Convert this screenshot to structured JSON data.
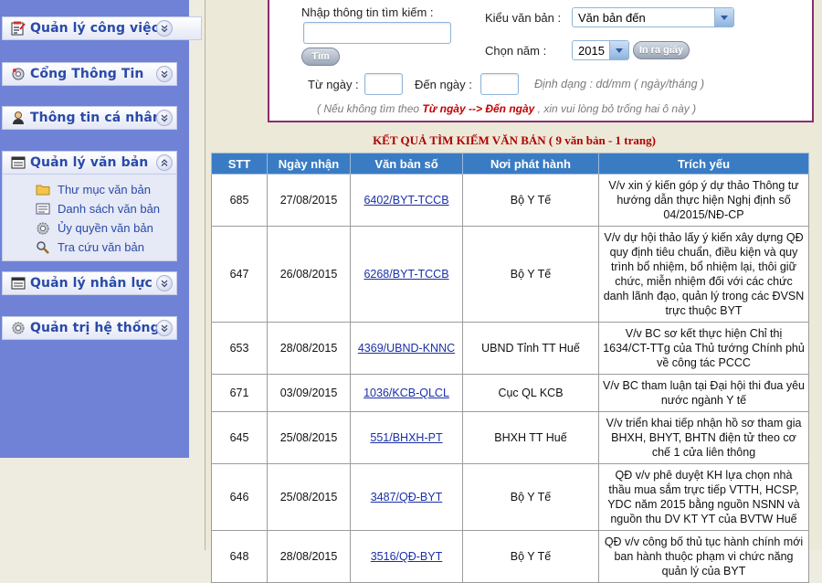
{
  "sidebar": {
    "sections": [
      {
        "title": "Quản lý công việc",
        "icon": "task-board-icon"
      },
      {
        "title": "Cổng Thông Tin",
        "icon": "portal-gear-icon"
      },
      {
        "title": "Thông tin cá nhân",
        "icon": "person-icon"
      },
      {
        "title": "Quản lý văn bản",
        "icon": "document-icon",
        "items": [
          {
            "label": "Thư mục văn bản",
            "icon": "folder-icon"
          },
          {
            "label": "Danh sách văn bản",
            "icon": "list-icon"
          },
          {
            "label": "Ủy quyền văn bản",
            "icon": "gear-icon"
          },
          {
            "label": "Tra cứu văn bản",
            "icon": "magnifier-icon"
          }
        ]
      },
      {
        "title": "Quản lý nhân lực",
        "icon": "document-icon"
      },
      {
        "title": "Quản trị hệ thống",
        "icon": "gear-icon"
      }
    ]
  },
  "search": {
    "keyword_label": "Nhập thông tin tìm kiếm :",
    "keyword_value": "",
    "search_button": "Tìm",
    "doc_type_label": "Kiểu văn bản :",
    "doc_type_value": "Văn bản đến",
    "year_label": "Chọn năm :",
    "year_value": "2015",
    "print_button": "In ra giấy",
    "from_label": "Từ ngày :",
    "to_label": "Đến ngày :",
    "format_hint": "Định dạng : dd/mm ( ngày/tháng )",
    "note_prefix": "( Nếu không tìm theo",
    "note_highlight": "Từ ngày --> Đến ngày",
    "note_suffix": ", xin vui lòng bỏ trống hai ô này )"
  },
  "results": {
    "title": "KẾT QUẢ TÌM KIẾM VĂN BẢN ( 9 văn bản - 1 trang)",
    "columns": [
      "STT",
      "Ngày nhận",
      "Văn bản số",
      "Nơi phát hành",
      "Trích yếu"
    ],
    "rows": [
      [
        "685",
        "27/08/2015",
        "6402/BYT-TCCB",
        "Bộ Y Tế",
        "V/v xin ý kiến góp ý dự thảo Thông tư hướng dẫn thực hiện Nghị định số 04/2015/NĐ-CP"
      ],
      [
        "647",
        "26/08/2015",
        "6268/BYT-TCCB",
        "Bộ Y Tế",
        "V/v dự hội thảo lấy ý kiến xây dựng QĐ quy định tiêu chuẩn, điều kiện và quy trình bổ nhiệm, bổ nhiệm lại, thôi giữ chức, miễn nhiệm đối với các chức danh lãnh đạo, quản lý trong các ĐVSN trực thuộc BYT"
      ],
      [
        "653",
        "28/08/2015",
        "4369/UBND-KNNC",
        "UBND Tỉnh TT Huế",
        "V/v BC sơ kết thực hiện Chỉ thị 1634/CT-TTg của Thủ tướng Chính phủ về công tác PCCC"
      ],
      [
        "671",
        "03/09/2015",
        "1036/KCB-QLCL",
        "Cục QL KCB",
        "V/v BC tham luận tại Đại hội thi đua yêu nước ngành Y tế"
      ],
      [
        "645",
        "25/08/2015",
        "551/BHXH-PT",
        "BHXH TT Huế",
        "V/v triển khai tiếp nhận hồ sơ tham gia BHXH, BHYT, BHTN điện tử theo cơ chế 1 cửa liên thông"
      ],
      [
        "646",
        "25/08/2015",
        "3487/QĐ-BYT",
        "Bộ Y Tế",
        "QĐ v/v phê duyệt KH lựa chọn nhà thầu mua sắm trực tiếp VTTH, HCSP, YDC năm 2015 bằng nguồn NSNN và nguồn thu DV KT YT của BVTW Huế"
      ],
      [
        "648",
        "28/08/2015",
        "3516/QĐ-BYT",
        "Bộ Y Tế",
        "QĐ v/v công bố thủ tục hành chính mới ban hành thuộc phạm vi chức năng quản lý của BYT"
      ]
    ]
  }
}
